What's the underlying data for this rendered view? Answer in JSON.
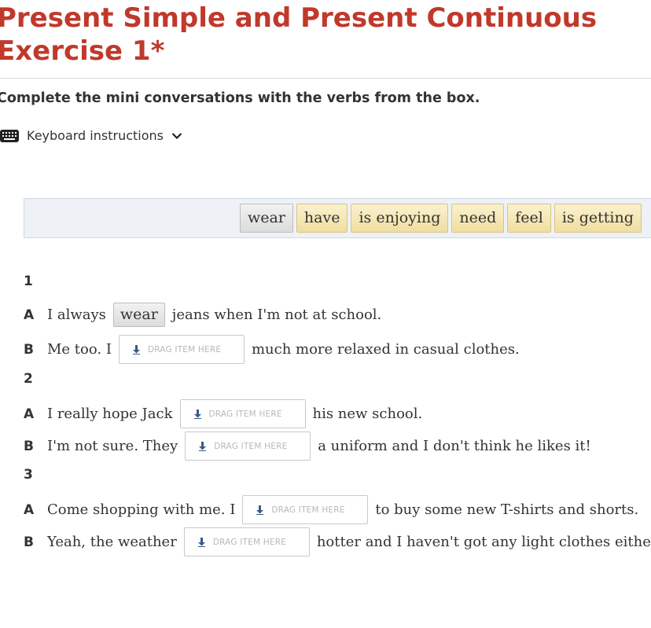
{
  "header": {
    "title": "Present Simple and Present Continuous\nExercise 1*",
    "instruction": "Complete the mini conversations with the verbs from the box."
  },
  "keyboard": {
    "label": "Keyboard instructions",
    "icon": "keyboard-icon",
    "toggle_icon": "chevron-down-icon"
  },
  "word_box": {
    "items": [
      {
        "label": "wear",
        "used": true
      },
      {
        "label": "have",
        "used": false
      },
      {
        "label": "is enjoying",
        "used": false
      },
      {
        "label": "need",
        "used": false
      },
      {
        "label": "feel",
        "used": false
      },
      {
        "label": "is getting",
        "used": false
      }
    ]
  },
  "drop_placeholder": "DRAG ITEM HERE",
  "questions": [
    {
      "number": "1",
      "lines": [
        {
          "speaker": "A",
          "before": "I always",
          "answer": "wear",
          "after": "jeans when I'm not at school."
        },
        {
          "speaker": "B",
          "before": "Me too. I",
          "answer": "",
          "after": "much more relaxed in casual clothes."
        }
      ]
    },
    {
      "number": "2",
      "lines": [
        {
          "speaker": "A",
          "before": "I really hope Jack",
          "answer": "",
          "after": "his new school."
        },
        {
          "speaker": "B",
          "before": "I'm not sure. They",
          "answer": "",
          "after": "a uniform and I don't think he likes it!"
        }
      ]
    },
    {
      "number": "3",
      "lines": [
        {
          "speaker": "A",
          "before": "Come shopping with me. I",
          "answer": "",
          "after": "to buy some new T-shirts and shorts."
        },
        {
          "speaker": "B",
          "before": "Yeah, the weather",
          "answer": "",
          "after": "hotter and I haven't got any light clothes either."
        }
      ]
    }
  ]
}
